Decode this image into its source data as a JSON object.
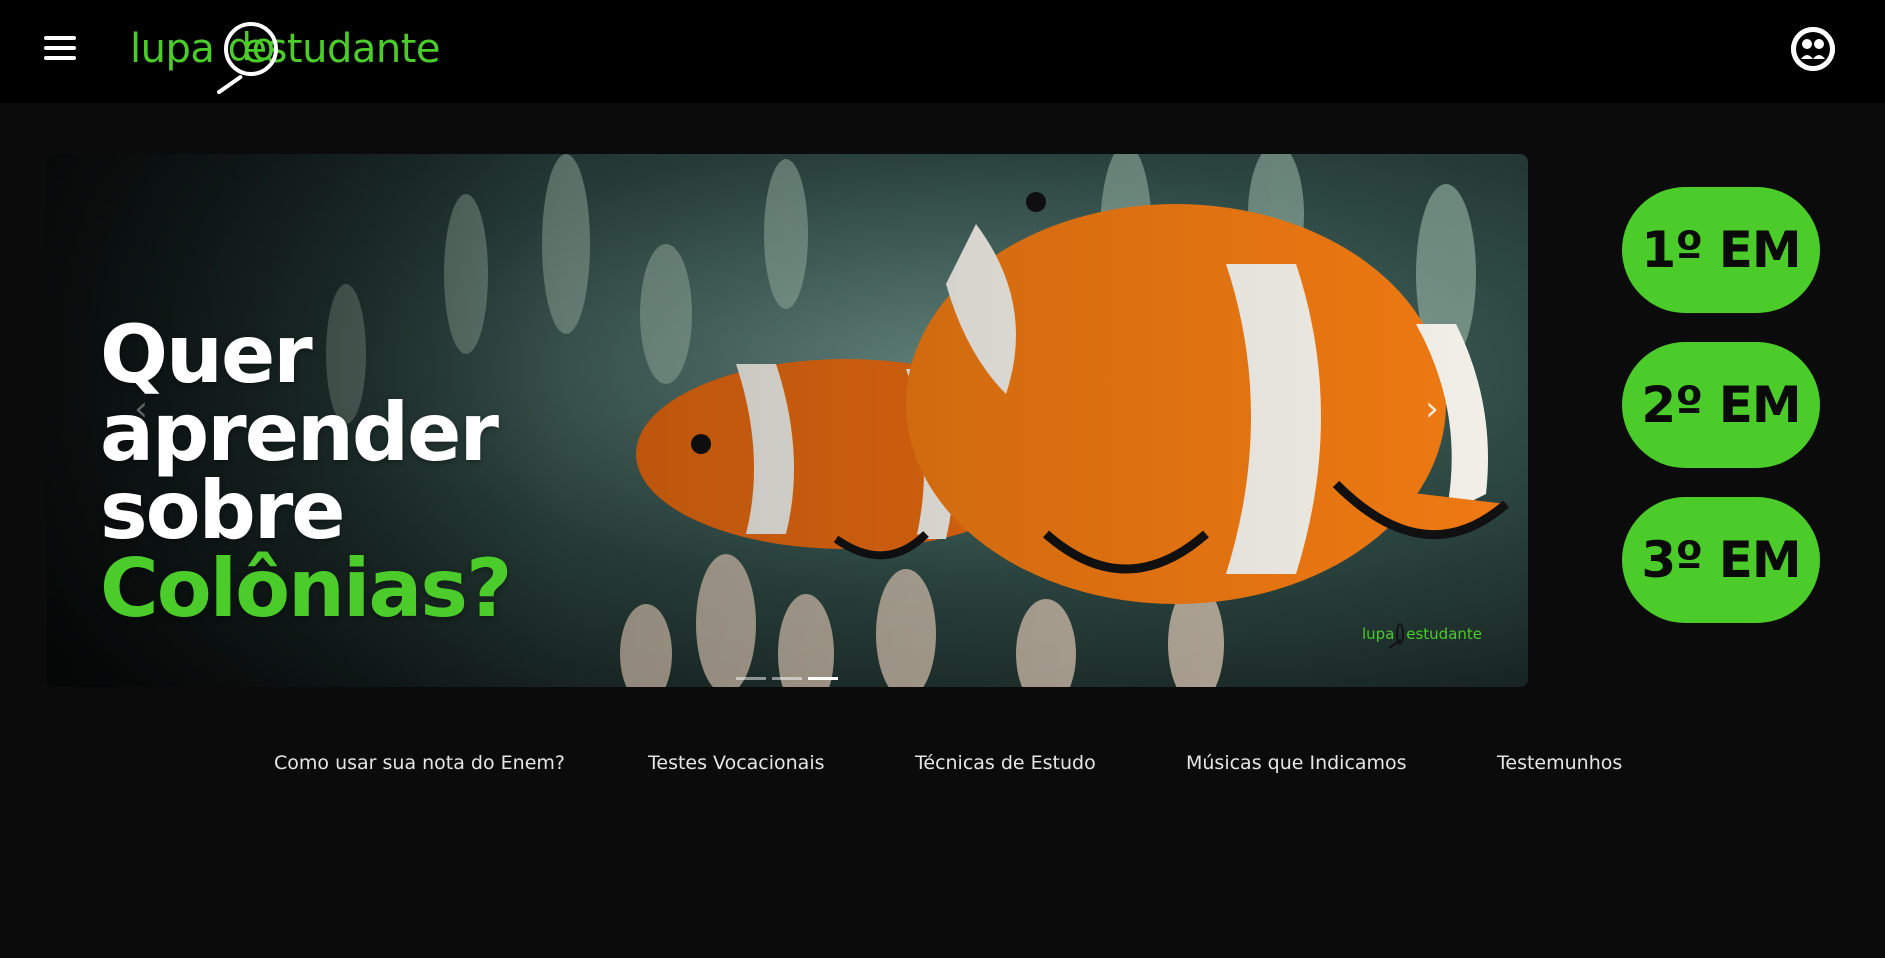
{
  "header": {
    "logo": {
      "part1": "lupa",
      "part2": "do",
      "part3": "estudante"
    },
    "menu_icon": "hamburger-menu-icon",
    "user_icon": "user-avatar-icon"
  },
  "carousel": {
    "headline": [
      "Quer",
      "aprender",
      "sobre",
      "Colônias?"
    ],
    "watermark": {
      "part1": "lupa",
      "part3": "estudante"
    },
    "prev_icon": "‹",
    "next_icon": "›",
    "slide_count": 3,
    "active_slide": 3
  },
  "grades": [
    "1º EM",
    "2º EM",
    "3º EM"
  ],
  "footer_links": [
    "Como usar sua nota do Enem?",
    "Testes Vocacionais",
    "Técnicas de Estudo",
    "Músicas que Indicamos",
    "Testemunhos"
  ],
  "colors": {
    "accent": "#4bcc2a",
    "header_bg": "#000000",
    "page_bg": "#0b0b0b"
  }
}
